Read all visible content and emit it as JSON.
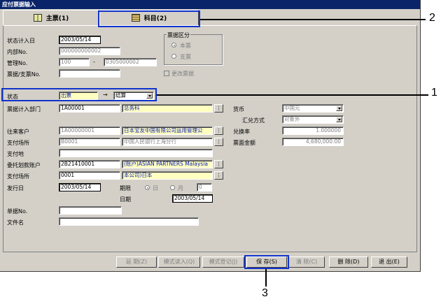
{
  "window": {
    "title": "应付票据输入"
  },
  "tabs": [
    {
      "label": "主票(1)"
    },
    {
      "label": "科目(2)"
    }
  ],
  "form": {
    "entry_date": {
      "label": "状态计入日",
      "value": "2003/05/14"
    },
    "internal_no": {
      "label": "内部No.",
      "value": "000000000002"
    },
    "manage_no": {
      "label": "管理No.",
      "value1": "100",
      "separator": "-",
      "value2": "0305000002"
    },
    "bill_no": {
      "label": "票据/支票No.",
      "value": ""
    },
    "bill_type": {
      "label": "票据区分",
      "options": [
        "本票",
        "支票"
      ]
    },
    "modify_bill": {
      "label": "更改票据"
    },
    "status": {
      "label": "状态",
      "from": "出票",
      "arrow": "→",
      "to": "结算"
    },
    "dept": {
      "label": "票据计入部门",
      "code": "1A00001",
      "name": "总务科"
    },
    "currency": {
      "label": "货币",
      "value": "中国元"
    },
    "fx_method": {
      "label": "汇兑方式",
      "value": "对象外"
    },
    "fx_rate": {
      "label": "兑换率",
      "value": "1.000000"
    },
    "amount": {
      "label": "票面金额",
      "value": "4,680,000.00"
    },
    "client": {
      "label": "往来客户",
      "code": "1A00000001",
      "name": "日本宝友中国有限公司运用管理公"
    },
    "pay_place": {
      "label": "支付场所",
      "code": "B0001",
      "name": "中国人民银行上海分行"
    },
    "pay_location": {
      "label": "支付地",
      "value": ""
    },
    "deposit_account": {
      "label": "委托划款账户",
      "code": "2B21410001",
      "name": "(账户)ASIAN PARTNERS Malaysia"
    },
    "pay_place2": {
      "label": "支付场所",
      "code": "0001",
      "name": "本公司)日本"
    },
    "issue_date": {
      "label": "发行日",
      "value": "2003/05/14"
    },
    "term": {
      "label": "期限",
      "day_label": "日",
      "month_label": "月",
      "value": "0"
    },
    "due_date": {
      "label": "日期",
      "value": "2003/05/14"
    },
    "slip_no": {
      "label": "单据No.",
      "value": ""
    },
    "file_name": {
      "label": "文件名",
      "value": ""
    },
    "search_btn_label": "⋮"
  },
  "buttons": [
    {
      "label": "延 期(Z)"
    },
    {
      "label": "模式读入(Q)"
    },
    {
      "label": "模式登记(J)"
    },
    {
      "label": "保 存(S)"
    },
    {
      "label": "清 除(C)"
    },
    {
      "label": "删 除(D)"
    },
    {
      "label": "退 出(E)"
    }
  ],
  "callouts": [
    "1",
    "2",
    "3"
  ]
}
